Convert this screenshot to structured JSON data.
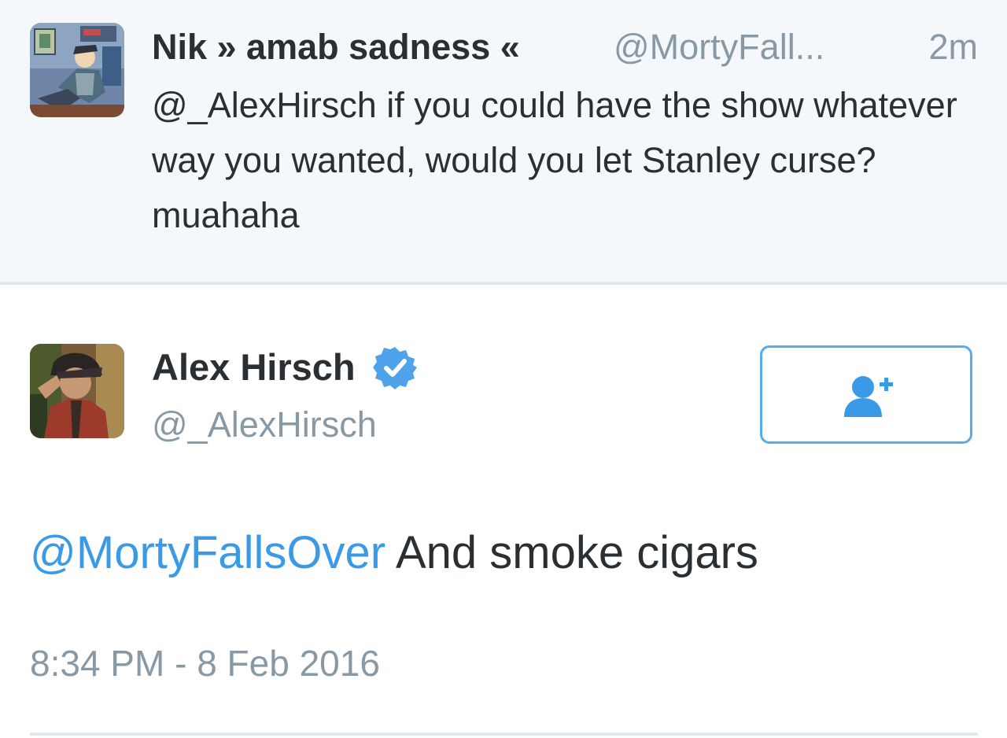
{
  "reply_context": {
    "display_name": "Nik » amab sadness «",
    "handle": "@MortyFall...",
    "time_ago": "2m",
    "text": "@_AlexHirsch if you could have the show whatever way you wanted, would you let Stanley curse? muahaha",
    "avatar_icon": "cartoon-avatar"
  },
  "tweet": {
    "display_name": "Alex Hirsch",
    "verified_icon": "verified-badge-icon",
    "handle": "@_AlexHirsch",
    "mention": "@MortyFallsOver",
    "body": "And smoke cigars",
    "timestamp": "8:34 PM - 8 Feb 2016",
    "follow_icon": "add-user-icon",
    "avatar_icon": "photo-avatar"
  },
  "colors": {
    "link": "#3a9ae6",
    "muted": "#8899a6",
    "text": "#292f33",
    "accent": "#55acee",
    "context_background": "#f5f8fa",
    "divider": "#e1e8ed"
  }
}
